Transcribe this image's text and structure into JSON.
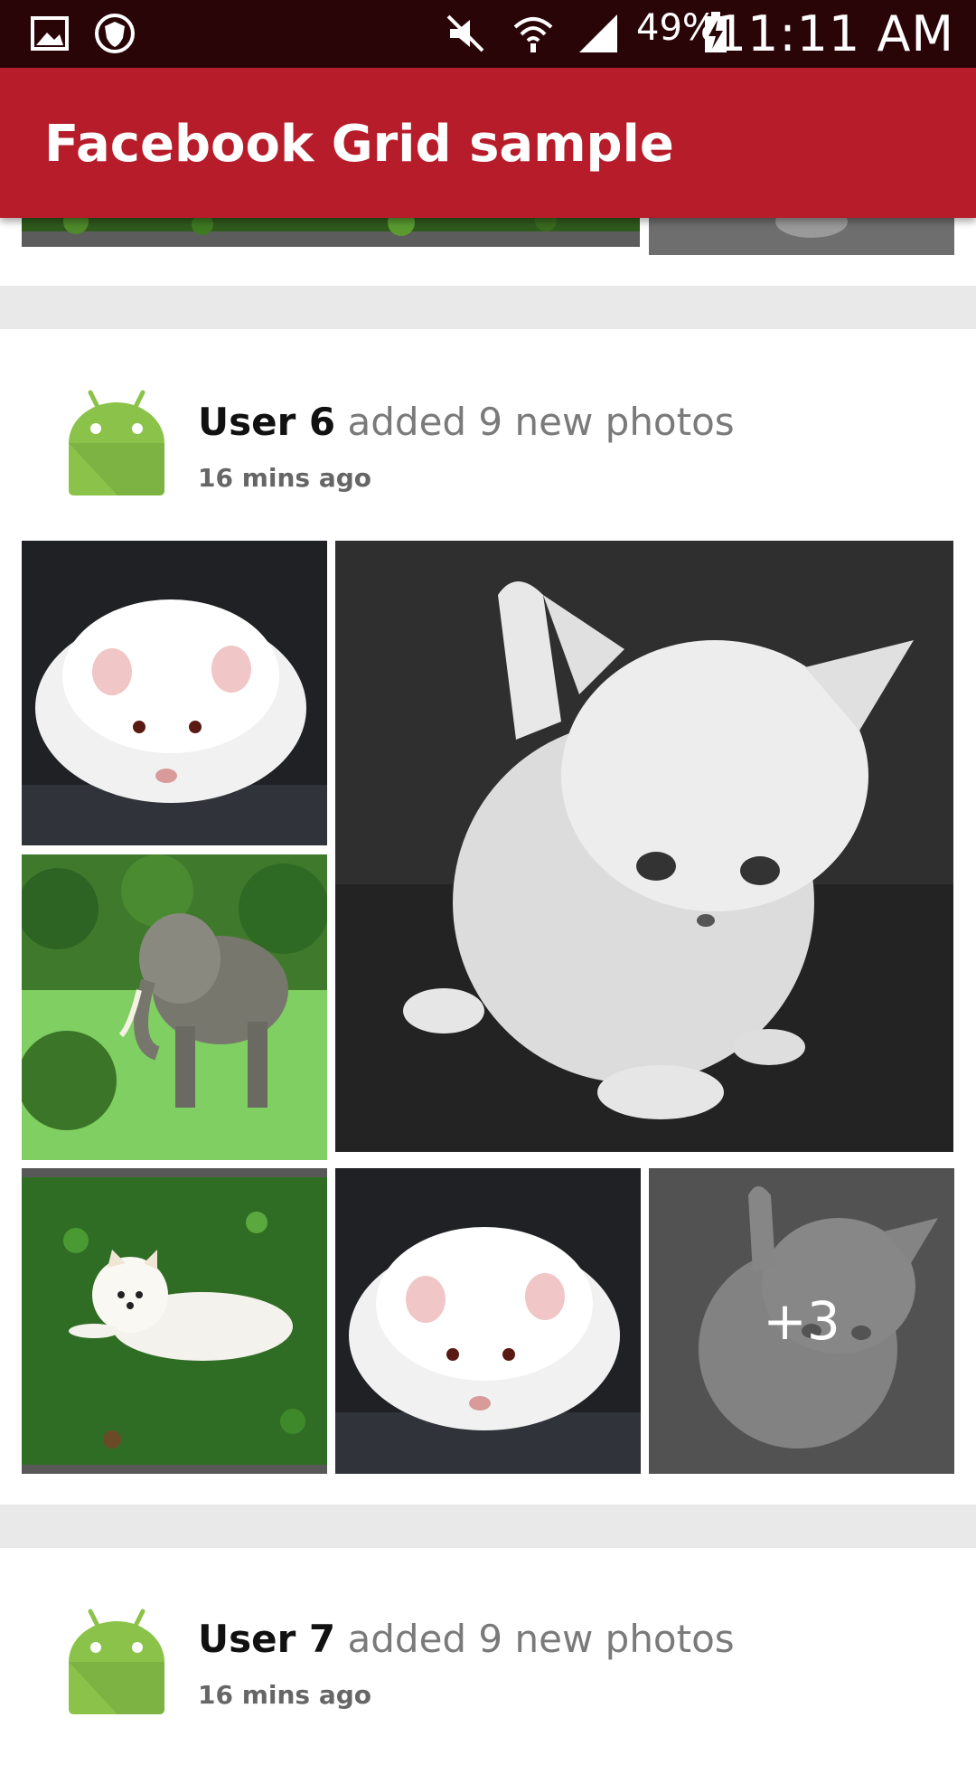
{
  "status_bar": {
    "battery": "49%",
    "time": "11:11 AM",
    "icons": [
      "gallery-icon",
      "shield-icon",
      "mute-icon",
      "wifi-icon",
      "signal-icon",
      "battery-icon"
    ]
  },
  "app_bar": {
    "title": "Facebook Grid sample",
    "color": "#b71c2a"
  },
  "posts": [
    {
      "user": "User 6",
      "action": "added 9 new photos",
      "time": "16 mins ago",
      "photos": [
        "hamster",
        "kitten",
        "elephant",
        "dog",
        "hamster",
        "kitten"
      ],
      "more_count": "+3"
    },
    {
      "user": "User 7",
      "action": "added 9 new photos",
      "time": "16 mins ago"
    }
  ]
}
